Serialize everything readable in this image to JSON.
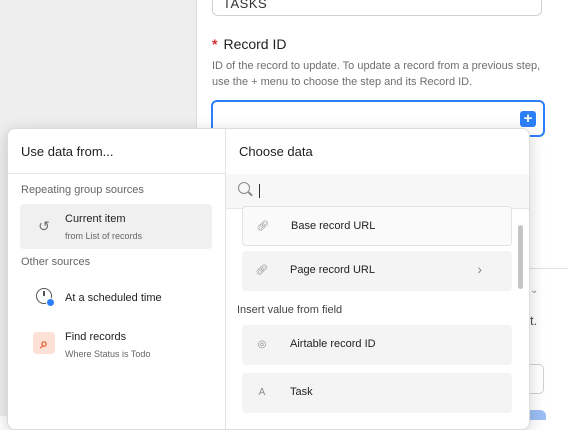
{
  "background": {
    "table_select_value": "TASKS",
    "record_field": {
      "label": "Record ID",
      "required_mark": "*",
      "help": "ID of the record to update. To update a record from a previous step, use the + menu to choose the step and its Record ID.",
      "plus_label": "+"
    },
    "partial_text": "t."
  },
  "popover": {
    "left": {
      "title": "Use data from...",
      "sections": [
        {
          "label": "Repeating group sources",
          "items": [
            {
              "title": "Current item",
              "subtitle": "from List of records",
              "icon": "undo-icon",
              "active": true
            }
          ]
        },
        {
          "label": "Other sources",
          "items": [
            {
              "title": "At a scheduled time",
              "subtitle": "",
              "icon": "clock-icon"
            },
            {
              "title": "Find records",
              "subtitle": "Where Status is Todo",
              "icon": "search-icon"
            }
          ]
        }
      ]
    },
    "right": {
      "title": "Choose data",
      "search_placeholder": "",
      "items": [
        {
          "label": "Base record URL",
          "icon": "link-icon"
        },
        {
          "label": "Page record URL",
          "icon": "link-icon",
          "has_submenu": true
        }
      ],
      "field_section_label": "Insert value from field",
      "field_items": [
        {
          "label": "Airtable record ID",
          "icon": "fingerprint-icon"
        },
        {
          "label": "Task",
          "icon": "text-icon"
        }
      ]
    }
  },
  "colors": {
    "accent": "#2d7ff9",
    "required": "#d2302f",
    "find_icon_bg": "#fde0d6",
    "find_icon_fg": "#e05a2a"
  }
}
